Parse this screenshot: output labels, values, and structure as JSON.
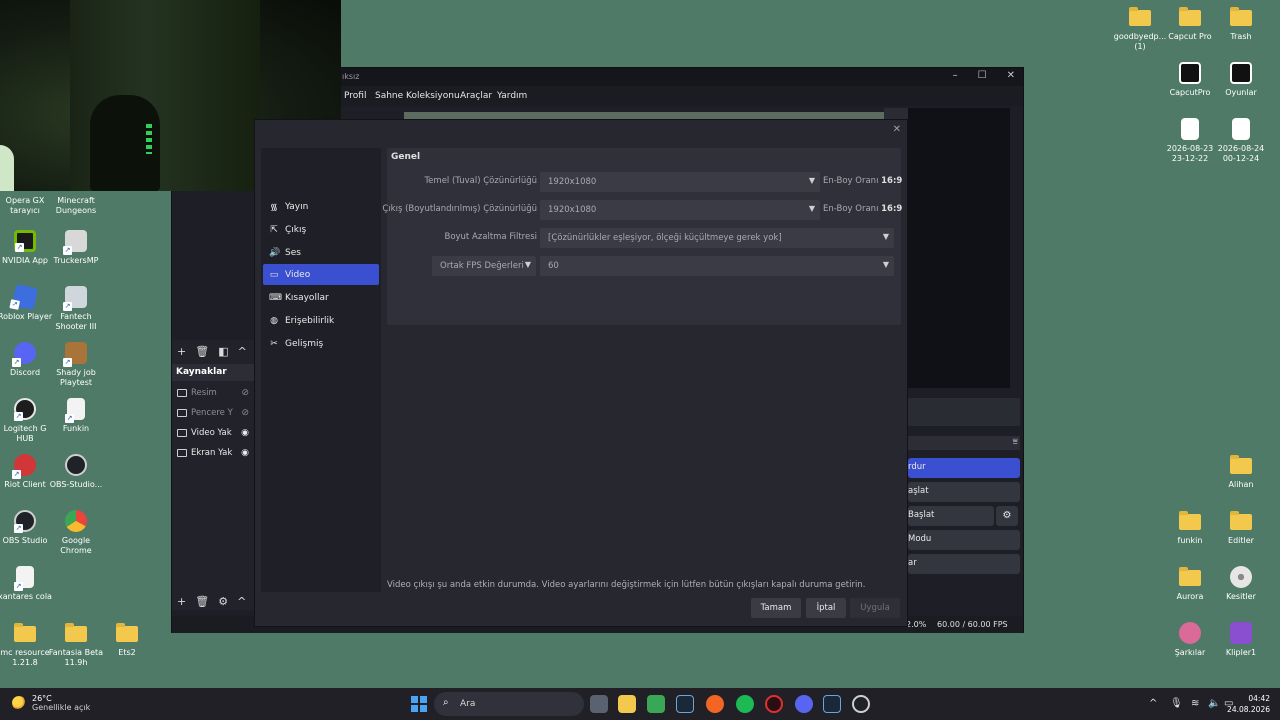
{
  "desktop": {
    "left_icons": [
      {
        "label": "Opera GX tarayıcı",
        "color": "#e0312d"
      },
      {
        "label": "Minecraft Dungeons",
        "color": "#8a5a3c"
      },
      {
        "label": "NVIDIA App",
        "color": "#76b900"
      },
      {
        "label": "TruckersMP",
        "color": "#d8d8d8"
      },
      {
        "label": "Roblox Player",
        "color": "#3d6ee0"
      },
      {
        "label": "Fantech Shooter III",
        "color": "#cfd6dc"
      },
      {
        "label": "Discord",
        "color": "#5865f2"
      },
      {
        "label": "Shady job Playtest",
        "color": "#a8743a"
      },
      {
        "label": "Logitech G HUB",
        "color": "#1d1d1d"
      },
      {
        "label": "Funkin",
        "color": "#f3f3f3"
      },
      {
        "label": "Riot Client",
        "color": "#d13639"
      },
      {
        "label": "OBS-Studio...",
        "color": "#1f2328"
      },
      {
        "label": "OBS Studio",
        "color": "#1f2328"
      },
      {
        "label": "Google Chrome",
        "color": "#e8453c"
      },
      {
        "label": "xantares cola",
        "color": "#f3f3f3"
      },
      {
        "label": "mc resource 1.21.8",
        "color": "#f2c94c"
      },
      {
        "label": "Fantasia Beta 11.9h",
        "color": "#f2c94c"
      },
      {
        "label": "Ets2",
        "color": "#f2c94c"
      }
    ],
    "right_icons": [
      {
        "label": "goodbyedp... (1)",
        "color": "#f2c94c"
      },
      {
        "label": "Capcut Pro",
        "color": "#f2c94c"
      },
      {
        "label": "Trash",
        "color": "#f2c94c"
      },
      {
        "label": "CapcutPro",
        "color": "#111111"
      },
      {
        "label": "Oyunlar",
        "color": "#111111"
      },
      {
        "label": "2026-08-23 23-12-22",
        "color": "#ffffff"
      },
      {
        "label": "2026-08-24 00-12-24",
        "color": "#ffffff"
      },
      {
        "label": "Alihan",
        "color": "#f2c94c"
      },
      {
        "label": "funkin",
        "color": "#f2c94c"
      },
      {
        "label": "Editler",
        "color": "#f2c94c"
      },
      {
        "label": "Aurora",
        "color": "#f2c94c"
      },
      {
        "label": "Kesitler",
        "color": "#d9d9d9"
      },
      {
        "label": "Şarkılar",
        "color": "#d96a9a"
      },
      {
        "label": "Klipler1",
        "color": "#8a4fd1"
      }
    ]
  },
  "obs": {
    "title_fragment": "ıksız",
    "menu": [
      "Profil",
      "Sahne Koleksiyonu",
      "Araçlar",
      "Yardım"
    ],
    "sources_header": "Kaynaklar",
    "sources": [
      {
        "label": "Resim",
        "visible": false
      },
      {
        "label": "Pencere Y",
        "visible": false
      },
      {
        "label": "Video Yak",
        "visible": true
      },
      {
        "label": "Ekran Yak",
        "visible": true
      }
    ],
    "controls": [
      "rdur",
      "aşlat",
      "Başlat",
      "Modu",
      "ar"
    ],
    "status_cpu": "2.0%",
    "status_fps": "60.00 / 60.00 FPS"
  },
  "settings": {
    "nav": [
      {
        "label": "Yayın",
        "icon": "antenna-icon"
      },
      {
        "label": "Çıkış",
        "icon": "output-icon"
      },
      {
        "label": "Ses",
        "icon": "speaker-icon"
      },
      {
        "label": "Video",
        "icon": "monitor-icon",
        "active": true
      },
      {
        "label": "Kısayollar",
        "icon": "keyboard-icon"
      },
      {
        "label": "Erişebilirlik",
        "icon": "accessibility-icon"
      },
      {
        "label": "Gelişmiş",
        "icon": "wrench-icon"
      }
    ],
    "group_title": "Genel",
    "base_label": "Temel (Tuval) Çözünürlüğü",
    "base_value": "1920x1080",
    "base_aspect_label": "En-Boy Oranı",
    "base_aspect_value": "16:9",
    "output_label": "Çıkış (Boyutlandırılmış) Çözünürlüğü",
    "output_value": "1920x1080",
    "output_aspect_label": "En-Boy Oranı",
    "output_aspect_value": "16:9",
    "filter_label": "Boyut Azaltma Filtresi",
    "filter_value": "[Çözünürlükler eşleşiyor, ölçeği küçültmeye gerek yok]",
    "fps_type": "Ortak FPS Değerleri",
    "fps_value": "60",
    "note": "Video çıkışı şu anda etkin durumda. Video ayarlarını değiştirmek için lütfen bütün çıkışları kapalı duruma getirin.",
    "btn_ok": "Tamam",
    "btn_cancel": "İptal",
    "btn_apply": "Uygula"
  },
  "taskbar": {
    "temp": "26°C",
    "weather": "Genellikle açık",
    "search_placeholder": "Ara",
    "time": "04:42",
    "date": "24.08.2026"
  }
}
